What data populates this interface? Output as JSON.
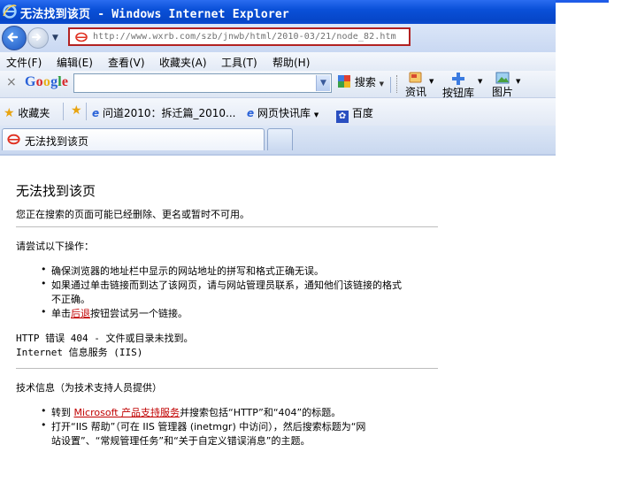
{
  "window": {
    "title": "无法找到该页 - Windows Internet Explorer"
  },
  "address": {
    "url": "http://www.wxrb.com/szb/jnwb/html/2010-03/21/node_82.htm"
  },
  "menu": [
    "文件(F)",
    "编辑(E)",
    "查看(V)",
    "收藏夹(A)",
    "工具(T)",
    "帮助(H)"
  ],
  "google": {
    "close": "×",
    "logo": "Google",
    "search_value": "",
    "search_label": "搜索",
    "news_label": "资讯",
    "buttons_label": "按钮库",
    "images_label": "图片"
  },
  "favorites": {
    "label": "收藏夹",
    "items": [
      "问道2010：拆迁篇_2010...",
      "网页快讯库",
      "百度"
    ]
  },
  "tab": {
    "title": "无法找到该页"
  },
  "content": {
    "heading": "无法找到该页",
    "intro": "您正在搜索的页面可能已经删除、更名或暂时不可用。",
    "try_heading": "请尝试以下操作：",
    "bullets": [
      "确保浏览器的地址栏中显示的网站地址的拼写和格式正确无误。",
      "如果通过单击链接而到达了该网页，请与网站管理员联系，通知他们该链接的格式",
      "不正确。"
    ],
    "back_pre": "单击",
    "back_link": "后退",
    "back_post": "按钮尝试另一个链接。",
    "error_line1": "HTTP 错误 404 - 文件或目录未找到。",
    "error_line2": "Internet 信息服务 (IIS)",
    "tech_heading": "技术信息（为技术支持人员提供）",
    "tech1_pre": "转到 ",
    "tech1_link": "Microsoft 产品支持服务",
    "tech1_post": "并搜索包括“HTTP”和“404”的标题。",
    "tech2_line1": "打开“IIS 帮助”（可在 IIS 管理器 (inetmgr) 中访问），然后搜索标题为“网",
    "tech2_line2": "站设置”、“常规管理任务”和“关于自定义错误消息”的主题。"
  },
  "colors": {
    "titlebar": "#0a50d8",
    "link": "#c00000",
    "addr_border": "#b22222"
  }
}
